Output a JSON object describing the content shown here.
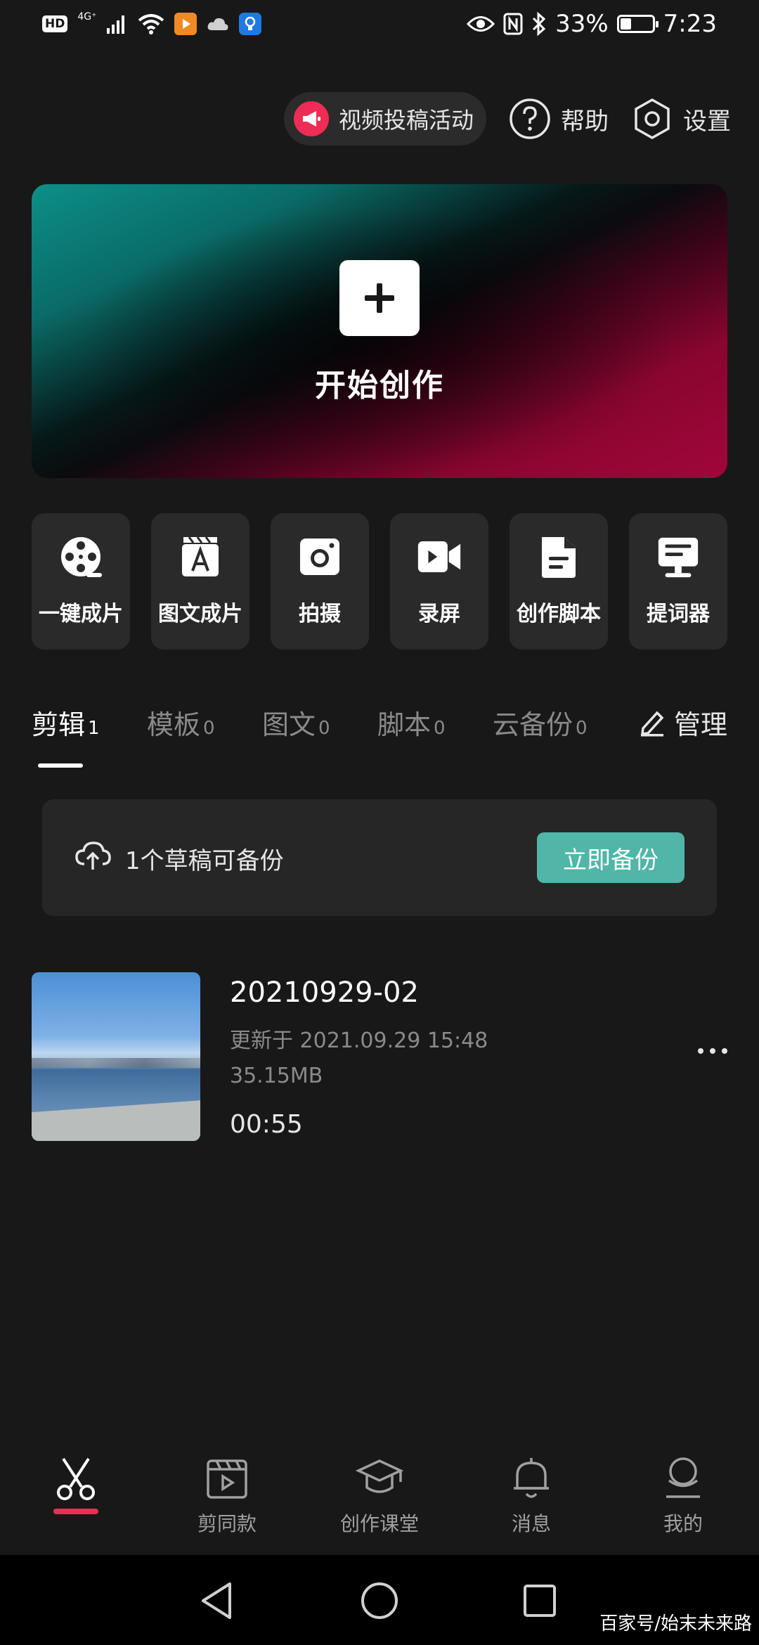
{
  "status_bar": {
    "left_hd": "HD",
    "network": "4G⁺",
    "battery_percent": "33%",
    "time": "7:23"
  },
  "top_actions": {
    "promo_label": "视频投稿活动",
    "help_label": "帮助",
    "settings_label": "设置"
  },
  "hero": {
    "title": "开始创作"
  },
  "tools": [
    {
      "label": "一键成片",
      "icon": "film-reel-icon"
    },
    {
      "label": "图文成片",
      "icon": "text-clapper-icon"
    },
    {
      "label": "拍摄",
      "icon": "camera-icon"
    },
    {
      "label": "录屏",
      "icon": "screen-record-icon"
    },
    {
      "label": "创作脚本",
      "icon": "script-doc-icon"
    },
    {
      "label": "提词器",
      "icon": "teleprompter-icon"
    }
  ],
  "tabs": [
    {
      "label": "剪辑",
      "count": "1",
      "active": true
    },
    {
      "label": "模板",
      "count": "0"
    },
    {
      "label": "图文",
      "count": "0"
    },
    {
      "label": "脚本",
      "count": "0"
    },
    {
      "label": "云备份",
      "count": "0"
    }
  ],
  "manage_label": "管理",
  "backup_card": {
    "text": "1个草稿可备份",
    "button": "立即备份"
  },
  "draft": {
    "title": "20210929-02",
    "updated": "更新于 2021.09.29 15:48",
    "size": "35.15MB",
    "duration": "00:55"
  },
  "bottom_nav": [
    {
      "label": "",
      "icon": "scissors-icon",
      "active": true
    },
    {
      "label": "剪同款",
      "icon": "template-clapper-icon"
    },
    {
      "label": "创作课堂",
      "icon": "graduation-cap-icon"
    },
    {
      "label": "消息",
      "icon": "bell-icon"
    },
    {
      "label": "我的",
      "icon": "profile-icon"
    }
  ],
  "watermark": "百家号/始末未来路",
  "colors": {
    "background": "#181818",
    "accent_red": "#ee2c55",
    "backup_button": "#4fb6a8"
  }
}
